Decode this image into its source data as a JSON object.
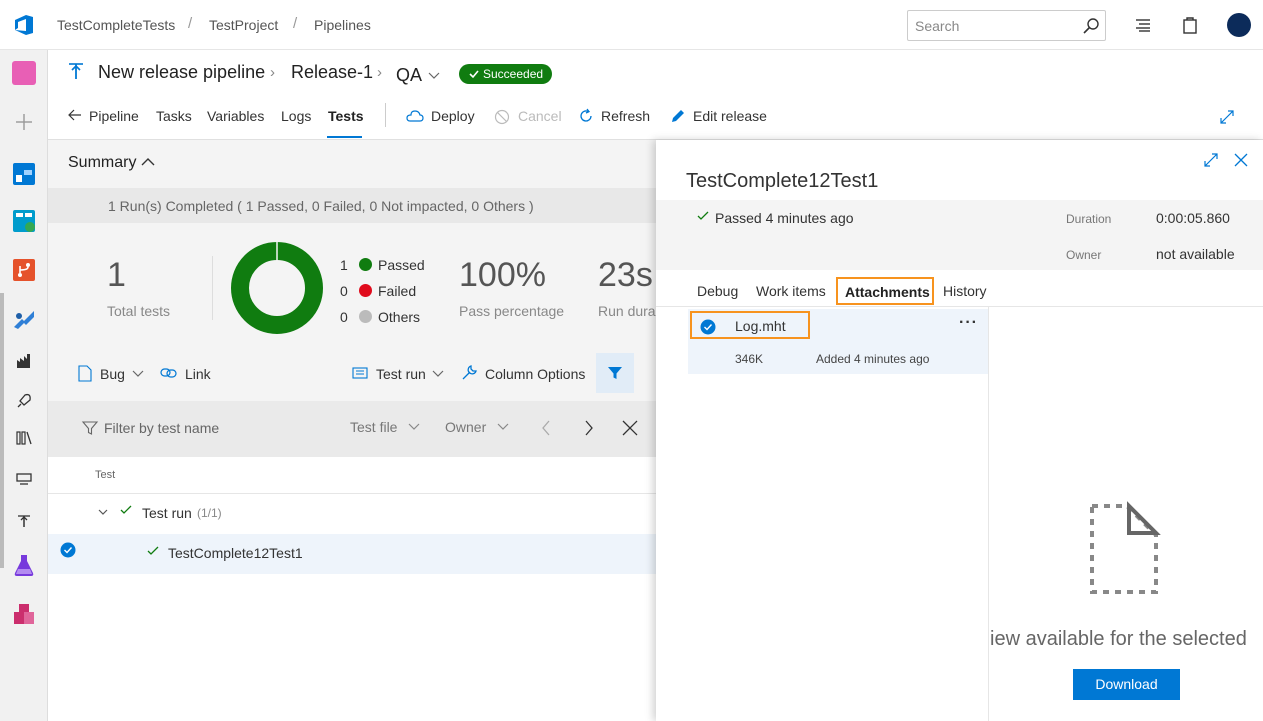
{
  "topbar": {
    "breadcrumbs": [
      "TestCompleteTests",
      "TestProject",
      "Pipelines"
    ],
    "search_placeholder": "Search"
  },
  "header": {
    "pipeline_name": "New release pipeline",
    "release_name": "Release-1",
    "stage_name": "QA",
    "status_badge": "Succeeded"
  },
  "tabs": {
    "pipeline": "Pipeline",
    "tasks": "Tasks",
    "variables": "Variables",
    "logs": "Logs",
    "tests": "Tests",
    "deploy": "Deploy",
    "cancel": "Cancel",
    "refresh": "Refresh",
    "edit_release": "Edit release"
  },
  "summary": {
    "title": "Summary",
    "runs_text": "1 Run(s) Completed ( 1 Passed, 0 Failed, 0 Not impacted, 0 Others )",
    "total_tests_value": "1",
    "total_tests_label": "Total tests",
    "legend": [
      {
        "count": "1",
        "label": "Passed",
        "color": "#107c10"
      },
      {
        "count": "0",
        "label": "Failed",
        "color": "#e00b1c"
      },
      {
        "count": "0",
        "label": "Others",
        "color": "#bbbbbb"
      }
    ],
    "pass_percentage_value": "100%",
    "pass_percentage_label": "Pass percentage",
    "run_duration_value": "23s",
    "run_duration_label": "Run dura"
  },
  "toolbar": {
    "bug": "Bug",
    "link": "Link",
    "test_run": "Test run",
    "column_options": "Column Options"
  },
  "filter": {
    "placeholder": "Filter by test name",
    "test_file": "Test file",
    "owner": "Owner"
  },
  "results_table": {
    "column_header": "Test",
    "group_label": "Test run",
    "group_count": "(1/1)",
    "test_name": "TestComplete12Test1"
  },
  "panel": {
    "title": "TestComplete12Test1",
    "status_text": "Passed 4 minutes ago",
    "duration_label": "Duration",
    "duration_value": "0:00:05.860",
    "owner_label": "Owner",
    "owner_value": "not available",
    "tabs": {
      "debug": "Debug",
      "work_items": "Work items",
      "attachments": "Attachments",
      "history": "History"
    },
    "attachment": {
      "name": "Log.mht",
      "size": "346K",
      "added": "Added 4 minutes ago"
    },
    "preview_message": "iew available for the selected",
    "download_label": "Download"
  },
  "colors": {
    "accent": "#0078d4",
    "success": "#107c10",
    "highlight": "#f7931e"
  }
}
